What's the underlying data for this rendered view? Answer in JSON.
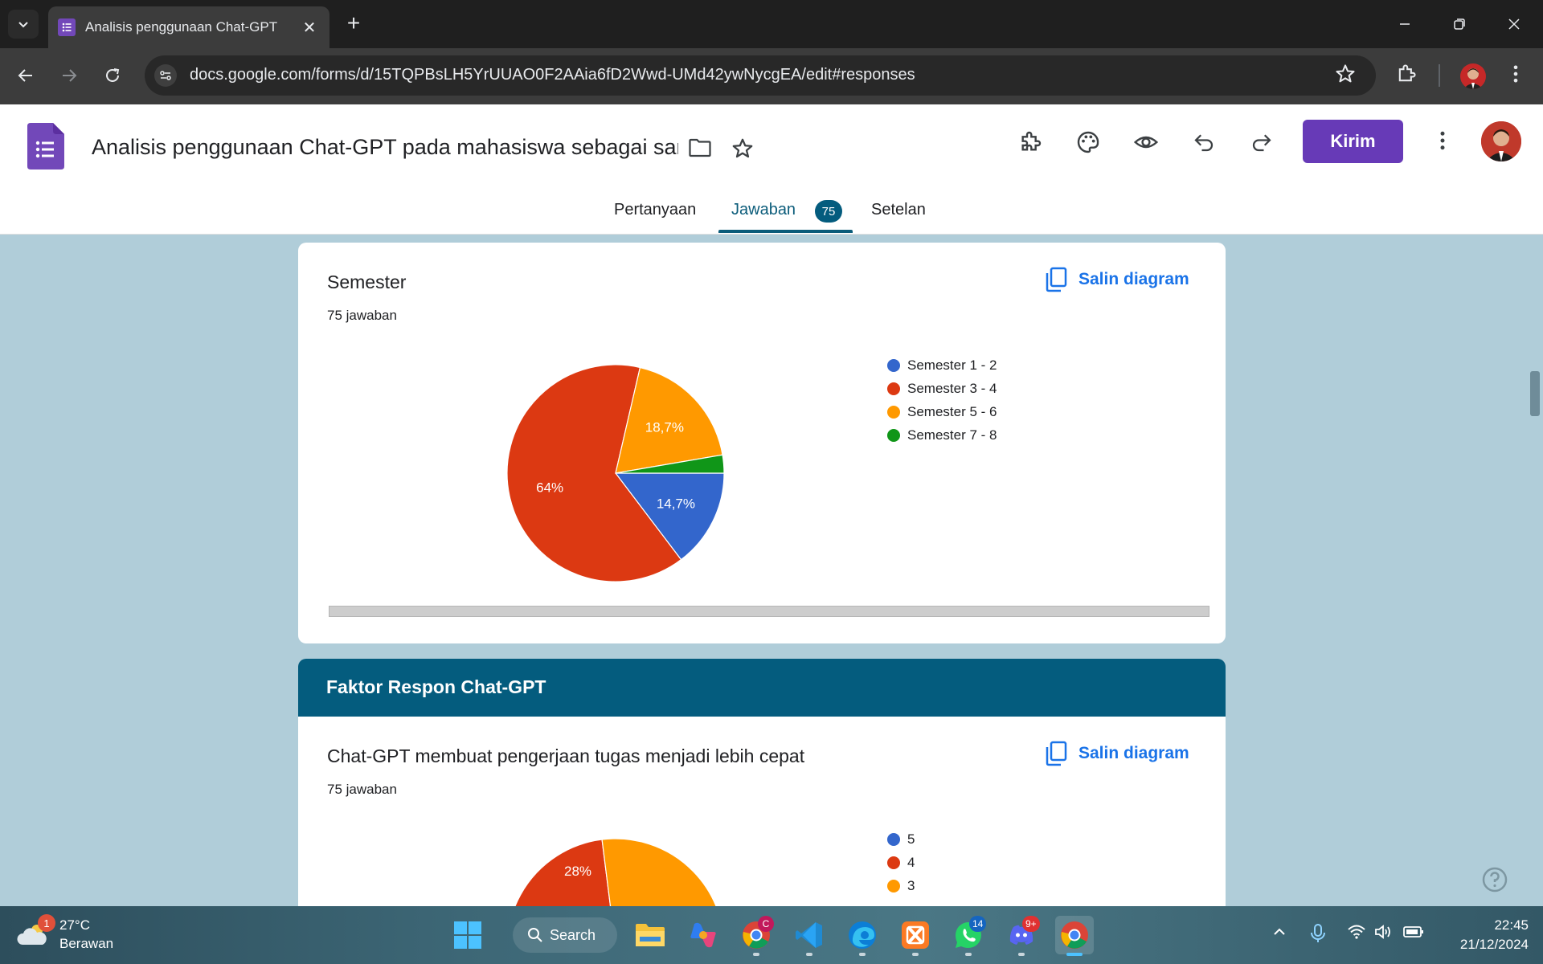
{
  "browser": {
    "tab_title": "Analisis penggunaan Chat-GPT",
    "url": "docs.google.com/forms/d/15TQPBsLH5YrUUAO0F2AAia6fD2Wwd-UMd42ywNycgEA/edit#responses"
  },
  "header": {
    "title": "Analisis penggunaan Chat-GPT pada mahasiswa sebagai sar",
    "send_label": "Kirim"
  },
  "tabs": {
    "questions": "Pertanyaan",
    "responses": "Jawaban",
    "response_count": "75",
    "settings": "Setelan"
  },
  "card1": {
    "title": "Semester",
    "subtitle": "75 jawaban",
    "copy_label": "Salin diagram"
  },
  "section": {
    "title": "Faktor Respon Chat-GPT"
  },
  "card2": {
    "title": "Chat-GPT membuat pengerjaan tugas menjadi lebih cepat",
    "subtitle": "75 jawaban",
    "copy_label": "Salin diagram"
  },
  "chart_data": [
    {
      "type": "pie",
      "title": "Semester",
      "categories": [
        "Semester 1 - 2",
        "Semester 3 - 4",
        "Semester 5 - 6",
        "Semester 7 - 8"
      ],
      "values": [
        14.7,
        64,
        18.7,
        2.7
      ],
      "labels": [
        "14,7%",
        "64%",
        "18,7%",
        ""
      ],
      "colors": [
        "#3366cc",
        "#dc3912",
        "#ff9900",
        "#109618"
      ],
      "legend_position": "right"
    },
    {
      "type": "pie",
      "title": "Chat-GPT membuat pengerjaan tugas menjadi lebih cepat",
      "categories": [
        "5",
        "4",
        "3"
      ],
      "visible_labels": [
        "28%"
      ],
      "colors": [
        "#3366cc",
        "#dc3912",
        "#ff9900"
      ],
      "legend_position": "right",
      "partially_visible": true
    }
  ],
  "taskbar": {
    "weather_temp": "27°C",
    "weather_desc": "Berawan",
    "weather_badge": "1",
    "search_label": "Search",
    "chrome_badge": "C",
    "whatsapp_badge": "14",
    "discord_badge": "9+",
    "time": "22:45",
    "date": "21/12/2024"
  },
  "icons": [
    "tab-search-icon",
    "forms-favicon",
    "close-icon",
    "plus-icon",
    "minimize-icon",
    "restore-icon",
    "window-close-icon",
    "back-icon",
    "forward-icon",
    "reload-icon",
    "site-info-icon",
    "bookmark-star-icon",
    "extensions-icon",
    "profile-icon",
    "more-vert-icon",
    "forms-logo",
    "folder-icon",
    "star-icon",
    "addon-icon",
    "palette-icon",
    "preview-eye-icon",
    "undo-icon",
    "redo-icon",
    "copy-icon",
    "help-icon",
    "weather-icon",
    "windows-start-icon",
    "search-icon",
    "file-explorer-icon",
    "copilot-icon",
    "chrome-icon",
    "vscode-icon",
    "edge-icon",
    "xampp-icon",
    "whatsapp-icon",
    "discord-icon",
    "chevron-up-icon",
    "microphone-icon",
    "wifi-icon",
    "volume-icon",
    "battery-icon"
  ]
}
